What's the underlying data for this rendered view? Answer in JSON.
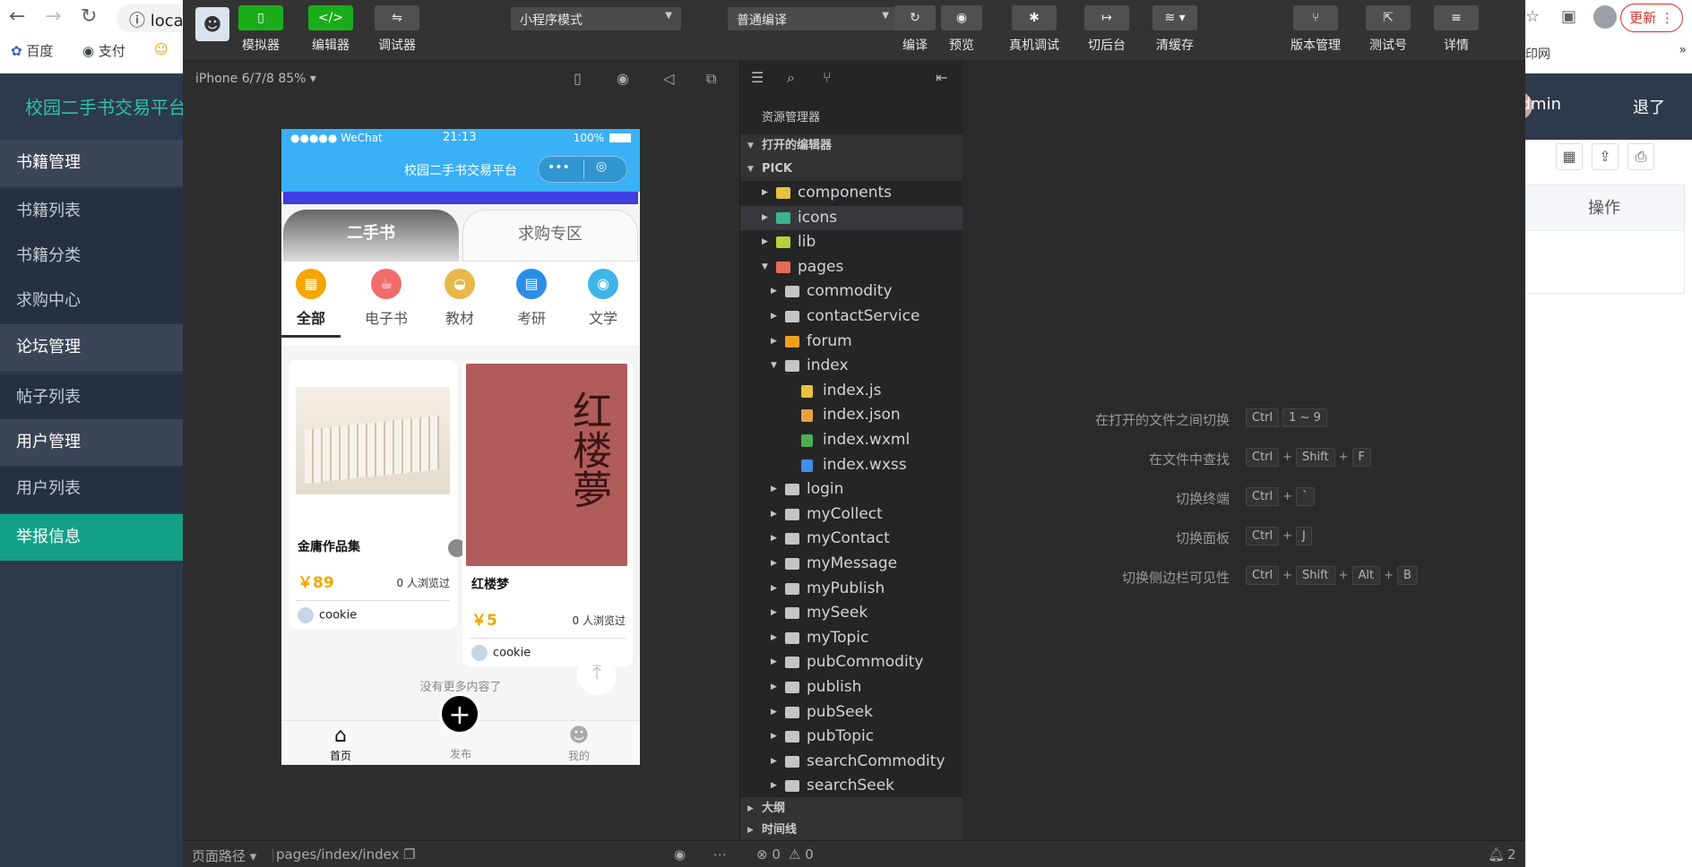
{
  "browser": {
    "address_text": "loca",
    "bookmarks": [
      "百度",
      "支付"
    ],
    "right_partial": "印网",
    "update_label": "更新"
  },
  "admin": {
    "brand": "校园二手书交易平台",
    "user": "admin",
    "logout": "退了",
    "ops_header": "操作",
    "sidebar": [
      {
        "label": "书籍管理",
        "kind": "group"
      },
      {
        "label": "书籍列表",
        "kind": "sub"
      },
      {
        "label": "书籍分类",
        "kind": "sub"
      },
      {
        "label": "求购中心",
        "kind": "sub"
      },
      {
        "label": "论坛管理",
        "kind": "group"
      },
      {
        "label": "帖子列表",
        "kind": "sub"
      },
      {
        "label": "用户管理",
        "kind": "group"
      },
      {
        "label": "用户列表",
        "kind": "sub"
      },
      {
        "label": "举报信息",
        "kind": "active"
      }
    ]
  },
  "devtools": {
    "toolbar": {
      "simulator": "模拟器",
      "editor": "编辑器",
      "debugger": "调试器",
      "mode_select": "小程序模式",
      "compile_select": "普通编译",
      "compile": "编译",
      "preview": "预览",
      "real_debug": "真机调试",
      "background": "切后台",
      "clear_cache": "清缓存",
      "version": "版本管理",
      "test_id": "测试号",
      "details": "详情"
    },
    "sim_device": "iPhone 6/7/8 85% ▾",
    "phone": {
      "carrier": "●●●●● WeChat",
      "time": "21:13",
      "battery": "100%",
      "nav_title": "校园二手书交易平台",
      "tab_secondhand": "二手书",
      "tab_wanted": "求购专区",
      "categories": [
        {
          "label": "全部",
          "color": "#f7a500",
          "icon": "grid-icon"
        },
        {
          "label": "电子书",
          "color": "#f26b6b",
          "icon": "cup-icon"
        },
        {
          "label": "教材",
          "color": "#e8b84c",
          "icon": "hat-icon"
        },
        {
          "label": "考研",
          "color": "#2a8ee8",
          "icon": "box-icon"
        },
        {
          "label": "文学",
          "color": "#3cb5e8",
          "icon": "camera-icon"
        }
      ],
      "cards": [
        {
          "title": "金庸作品集",
          "price": "￥89",
          "views": "0 人浏览过",
          "user": "cookie"
        },
        {
          "title": "红楼梦",
          "price": "￥5",
          "views": "0 人浏览过",
          "user": "cookie"
        }
      ],
      "no_more": "没有更多内容了",
      "tabbar": [
        "首页",
        "发布",
        "我的"
      ]
    },
    "explorer": {
      "title": "资源管理器",
      "open_editors": "打开的编辑器",
      "project": "PICK",
      "outline": "大纲",
      "timeline": "时间线",
      "tree": [
        {
          "name": "components",
          "depth": 0,
          "state": "collapsed",
          "type": "folder-special",
          "color": "#e8c23c"
        },
        {
          "name": "icons",
          "depth": 0,
          "state": "collapsed",
          "type": "folder-special",
          "color": "#3bb58a",
          "selected": true
        },
        {
          "name": "lib",
          "depth": 0,
          "state": "collapsed",
          "type": "folder-special",
          "color": "#b5d13c"
        },
        {
          "name": "pages",
          "depth": 0,
          "state": "expanded",
          "type": "folder-special",
          "color": "#e86b5a"
        },
        {
          "name": "commodity",
          "depth": 1,
          "state": "collapsed",
          "type": "folder",
          "color": "#c5c5c5"
        },
        {
          "name": "contactService",
          "depth": 1,
          "state": "collapsed",
          "type": "folder",
          "color": "#c5c5c5"
        },
        {
          "name": "forum",
          "depth": 1,
          "state": "collapsed",
          "type": "folder",
          "color": "#f0a020"
        },
        {
          "name": "index",
          "depth": 1,
          "state": "expanded",
          "type": "folder",
          "color": "#c5c5c5"
        },
        {
          "name": "index.js",
          "depth": 2,
          "state": "none",
          "type": "file",
          "color": "#e8c23c"
        },
        {
          "name": "index.json",
          "depth": 2,
          "state": "none",
          "type": "file",
          "color": "#e8a23c"
        },
        {
          "name": "index.wxml",
          "depth": 2,
          "state": "none",
          "type": "file",
          "color": "#4caf50"
        },
        {
          "name": "index.wxss",
          "depth": 2,
          "state": "none",
          "type": "file",
          "color": "#3c8ee8"
        },
        {
          "name": "login",
          "depth": 1,
          "state": "collapsed",
          "type": "folder",
          "color": "#c5c5c5"
        },
        {
          "name": "myCollect",
          "depth": 1,
          "state": "collapsed",
          "type": "folder",
          "color": "#c5c5c5"
        },
        {
          "name": "myContact",
          "depth": 1,
          "state": "collapsed",
          "type": "folder",
          "color": "#c5c5c5"
        },
        {
          "name": "myMessage",
          "depth": 1,
          "state": "collapsed",
          "type": "folder",
          "color": "#c5c5c5"
        },
        {
          "name": "myPublish",
          "depth": 1,
          "state": "collapsed",
          "type": "folder",
          "color": "#c5c5c5"
        },
        {
          "name": "mySeek",
          "depth": 1,
          "state": "collapsed",
          "type": "folder",
          "color": "#c5c5c5"
        },
        {
          "name": "myTopic",
          "depth": 1,
          "state": "collapsed",
          "type": "folder",
          "color": "#c5c5c5"
        },
        {
          "name": "pubCommodity",
          "depth": 1,
          "state": "collapsed",
          "type": "folder",
          "color": "#c5c5c5"
        },
        {
          "name": "publish",
          "depth": 1,
          "state": "collapsed",
          "type": "folder",
          "color": "#c5c5c5"
        },
        {
          "name": "pubSeek",
          "depth": 1,
          "state": "collapsed",
          "type": "folder",
          "color": "#c5c5c5"
        },
        {
          "name": "pubTopic",
          "depth": 1,
          "state": "collapsed",
          "type": "folder",
          "color": "#c5c5c5"
        },
        {
          "name": "searchCommodity",
          "depth": 1,
          "state": "collapsed",
          "type": "folder",
          "color": "#c5c5c5"
        },
        {
          "name": "searchSeek",
          "depth": 1,
          "state": "collapsed",
          "type": "folder",
          "color": "#c5c5c5"
        }
      ]
    },
    "shortcuts": [
      {
        "label": "在打开的文件之间切换",
        "keys": [
          "Ctrl",
          "1 ~ 9"
        ]
      },
      {
        "label": "在文件中查找",
        "keys": [
          "Ctrl",
          "+",
          "Shift",
          "+",
          "F"
        ]
      },
      {
        "label": "切换终端",
        "keys": [
          "Ctrl",
          "+",
          "`"
        ]
      },
      {
        "label": "切换面板",
        "keys": [
          "Ctrl",
          "+",
          "J"
        ]
      },
      {
        "label": "切换侧边栏可见性",
        "keys": [
          "Ctrl",
          "+",
          "Shift",
          "+",
          "Alt",
          "+",
          "B"
        ]
      }
    ],
    "status": {
      "page_path_label": "页面路径 ▾",
      "page_path": "pages/index/index",
      "errors": "⊗ 0",
      "warnings": "⚠ 0",
      "notifications": "2"
    }
  }
}
